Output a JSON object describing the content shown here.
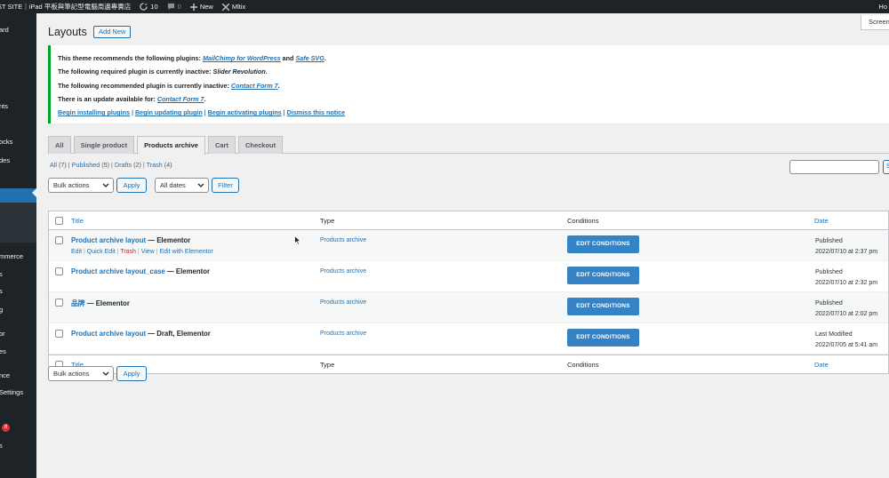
{
  "admin_bar": {
    "site_name": "ST SITE｜iPad 平板與筆記型電腦周邊專賣店",
    "updates_count": "10",
    "comments_count": "0",
    "new_label": "New",
    "mltix_label": "Mltix",
    "howdy": "Ho"
  },
  "sidebar": {
    "items": [
      {
        "label": "ard"
      },
      {
        "label": "nts"
      },
      {
        "label": "ocks"
      },
      {
        "label": "des"
      },
      {
        "label": "mmerce"
      },
      {
        "label": "s"
      },
      {
        "label": "s"
      },
      {
        "label": "g"
      },
      {
        "label": "or"
      },
      {
        "label": "es"
      },
      {
        "label": "nce"
      },
      {
        "label": "Settings"
      },
      {
        "label": "s"
      }
    ],
    "badge": "8"
  },
  "header": {
    "screen_options": "Screen",
    "title": "Layouts",
    "add_new": "Add New"
  },
  "notice": {
    "line1_prefix": "This theme recommends the following plugins:",
    "line1_plugin1": "MailChimp for WordPress",
    "line1_and": "and",
    "line1_plugin2": "Safe SVG",
    "line1_end": ".",
    "line2_prefix": "The following required plugin is currently inactive:",
    "line2_plugin": "Slider Revolution",
    "line2_end": ".",
    "line3_prefix": "The following recommended plugin is currently inactive:",
    "line3_plugin": "Contact Form 7",
    "line3_end": ".",
    "line4_prefix": "There is an update available for:",
    "line4_plugin": "Contact Form 7",
    "line4_end": ".",
    "links": [
      "Begin installing plugins",
      "Begin updating plugin",
      "Begin activating plugins",
      "Dismiss this notice"
    ]
  },
  "tabs": [
    "All",
    "Single product",
    "Products archive",
    "Cart",
    "Checkout"
  ],
  "active_tab": "Products archive",
  "filters": {
    "all": "All",
    "all_count": "(7)",
    "published": "Published",
    "published_count": "(5)",
    "drafts": "Drafts",
    "drafts_count": "(2)",
    "trash": "Trash",
    "trash_count": "(4)"
  },
  "search_button": "S",
  "bulk_actions": "Bulk actions",
  "apply": "Apply",
  "all_dates": "All dates",
  "filter": "Filter",
  "table": {
    "headers": {
      "title": "Title",
      "type": "Type",
      "conditions": "Conditions",
      "date": "Date"
    },
    "rows": [
      {
        "title": "Product archive layout",
        "state": " — Elementor",
        "type": "Products archive",
        "action": "EDIT CONDITIONS",
        "status": "Published",
        "date": "2022/07/10 at 2:37 pm"
      },
      {
        "title": "Product archive layout_case",
        "state": " — Elementor",
        "type": "Products archive",
        "action": "EDIT CONDITIONS",
        "status": "Published",
        "date": "2022/07/10 at 2:32 pm"
      },
      {
        "title": "品牌",
        "state": " — Elementor",
        "type": "Products archive",
        "action": "EDIT CONDITIONS",
        "status": "Published",
        "date": "2022/07/10 at 2:02 pm"
      },
      {
        "title": "Product archive layout",
        "state": " — Draft, Elementor",
        "type": "Products archive",
        "action": "EDIT CONDITIONS",
        "status": "Last Modified",
        "date": "2022/07/05 at 5:41 am"
      }
    ],
    "row_actions": {
      "edit": "Edit",
      "quick_edit": "Quick Edit",
      "trash": "Trash",
      "view": "View",
      "edit_elementor": "Edit with Elementor",
      "sep": "|"
    }
  },
  "colors": {
    "primary": "#2271b1",
    "button_blue": "#3582c4",
    "notice_green": "#00a32a",
    "dark": "#1d2327",
    "trash_red": "#b32d2e"
  }
}
